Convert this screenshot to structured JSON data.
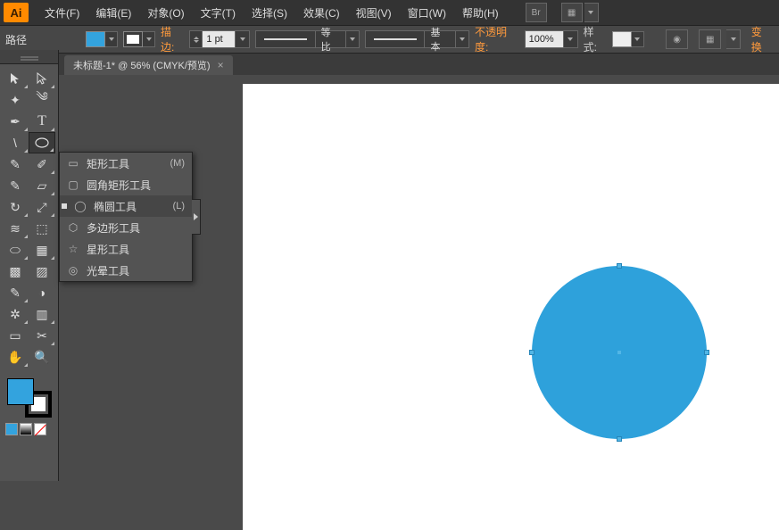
{
  "app": {
    "name": "Ai"
  },
  "menu": {
    "file": "文件(F)",
    "edit": "编辑(E)",
    "object": "对象(O)",
    "type": "文字(T)",
    "select": "选择(S)",
    "effect": "效果(C)",
    "view": "视图(V)",
    "window": "窗口(W)",
    "help": "帮助(H)",
    "bridge": "Br"
  },
  "path_label": "路径",
  "options": {
    "fill_color": "#33a3de",
    "stroke_color": "#ffffff",
    "stroke_label": "描边:",
    "stroke_weight": "1 pt",
    "profile_label": "等比",
    "brush_label": "基本",
    "opacity_label": "不透明度:",
    "opacity_value": "100%",
    "style_label": "样式:",
    "transform_label": "变换"
  },
  "doc": {
    "title": "未标题-1* @ 56% (CMYK/预览)"
  },
  "tools": {
    "selection": "▲",
    "direct": "▲",
    "wand": "✦",
    "lasso": "◯",
    "pen": "✒",
    "type": "T",
    "line": "\\",
    "ellipse": "◯",
    "brush": "✎",
    "pencil": "✎",
    "blob": "●",
    "eraser": "▱",
    "rotate": "↻",
    "reflect": "⇔",
    "scale": "⤢",
    "warp": "⌇",
    "width": "≡",
    "free": "⬚",
    "shape": "⬭",
    "perspective": "▦",
    "mesh": "▩",
    "gradient": "▨",
    "eyedrop": "✎",
    "blend": "◑",
    "symbol": "✷",
    "graph": "▥",
    "artboard": "▭",
    "slice": "⧫",
    "hand": "✋",
    "zoom": "🔍"
  },
  "mini": {
    "color": "#33a3de"
  },
  "flyout": {
    "items": [
      {
        "icon": "▭",
        "label": "矩形工具",
        "shortcut": "(M)"
      },
      {
        "icon": "▢",
        "label": "圆角矩形工具",
        "shortcut": ""
      },
      {
        "icon": "◯",
        "label": "椭圆工具",
        "shortcut": "(L)"
      },
      {
        "icon": "⬡",
        "label": "多边形工具",
        "shortcut": ""
      },
      {
        "icon": "☆",
        "label": "星形工具",
        "shortcut": ""
      },
      {
        "icon": "◎",
        "label": "光晕工具",
        "shortcut": ""
      }
    ]
  }
}
